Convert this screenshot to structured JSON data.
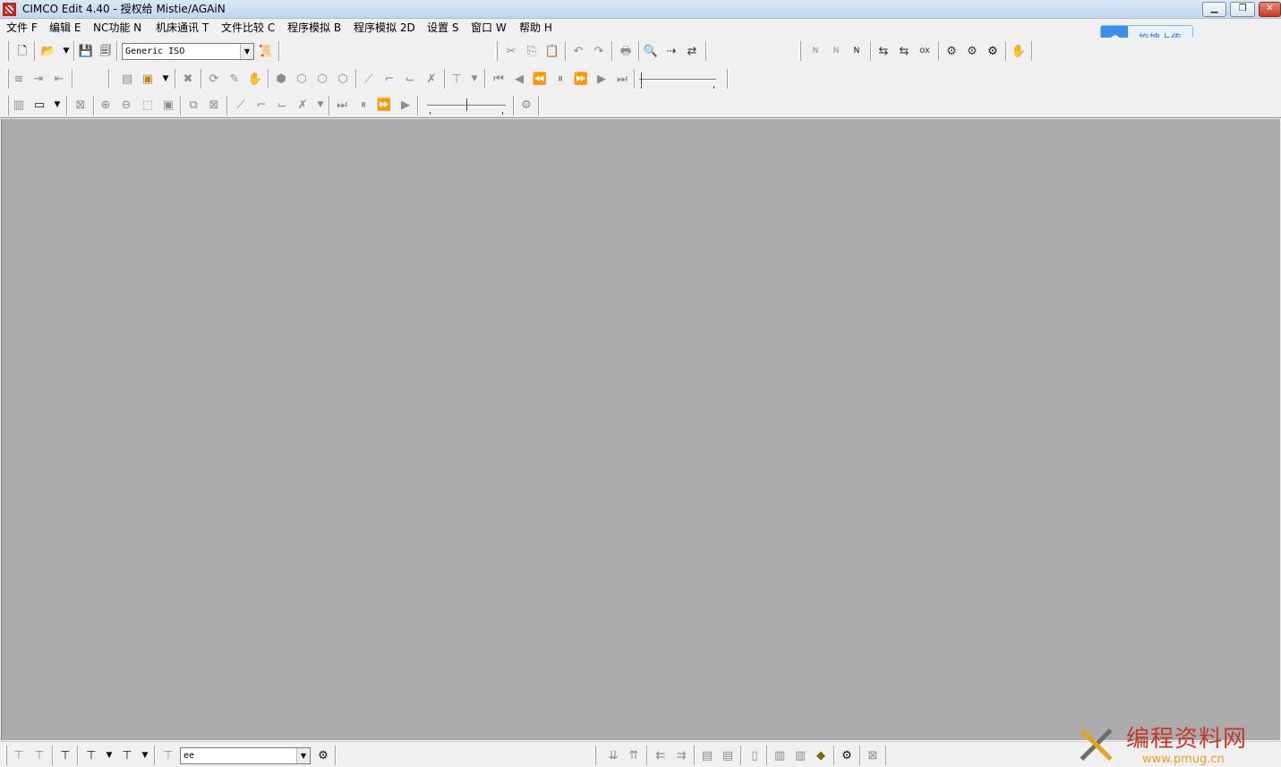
{
  "window": {
    "title": "CIMCO Edit 4.40 - 授权给 Mistie/AGAiN",
    "buttons": {
      "minimize": "▁",
      "maximize": "❐",
      "close": "✕"
    }
  },
  "menu": [
    {
      "label": "文件 F"
    },
    {
      "label": "编辑 E"
    },
    {
      "label": "NC功能 N"
    },
    {
      "label": "机床通讯 T"
    },
    {
      "label": "文件比较 C"
    },
    {
      "label": "程序模拟 B"
    },
    {
      "label": "程序模拟 2D"
    },
    {
      "label": "设置 S"
    },
    {
      "label": "窗口 W"
    },
    {
      "label": "帮助 H"
    }
  ],
  "upload_badge": {
    "label": "拖拽上传",
    "icon": "cloud-icon"
  },
  "toolbar": {
    "machine_select": {
      "value": "Generic ISO"
    },
    "icons": {
      "new": "🗋",
      "open": "📂",
      "save": "💾",
      "save_all": "🗐",
      "post": "📜",
      "cut": "✂",
      "copy": "⎘",
      "paste": "📋",
      "undo": "↶",
      "redo": "↷",
      "print": "🖶",
      "find": "🔍",
      "find_next": "⇢",
      "replace": "⇄",
      "renumber": "N",
      "remove_numbers": "N",
      "remove_spaces": "N",
      "insert_spaces": "⇆",
      "remove_comments": "⇆",
      "ox": "ox",
      "tool": "⚙",
      "settings": "⚙",
      "config": "⚙",
      "hand": "✋"
    }
  },
  "bottom_toolbar": {
    "field": {
      "value": "ee"
    }
  },
  "watermark": {
    "title": "编程资料网",
    "url": "www.pmug.cn"
  }
}
